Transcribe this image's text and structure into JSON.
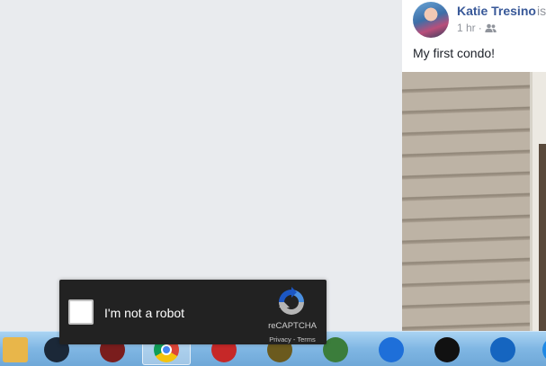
{
  "post": {
    "author": "Katie Tresino",
    "author_suffix": "is",
    "time": "1 hr",
    "separator": "·",
    "privacy_icon": "friends-icon",
    "text": "My first condo!"
  },
  "captcha": {
    "label": "I'm not a robot",
    "brand": "reCAPTCHA",
    "privacy_link": "Privacy",
    "link_separator": "-",
    "terms_link": "Terms",
    "logo_icon": "recaptcha-logo-icon"
  },
  "taskbar": {
    "apps": [
      {
        "icon": "file-explorer-icon",
        "color": "#e8b64a"
      },
      {
        "icon": "steam-icon",
        "color": "#1b2838"
      },
      {
        "icon": "gear-app-icon",
        "color": "#7a1d1d"
      },
      {
        "icon": "chrome-icon",
        "color": "#4285f4",
        "active": true
      },
      {
        "icon": "security-shield-icon",
        "color": "#c62828"
      },
      {
        "icon": "game-icon",
        "color": "#6b5a1e"
      },
      {
        "icon": "shield-app-icon",
        "color": "#3b7d3b"
      },
      {
        "icon": "g-app-icon",
        "color": "#1e6fd9"
      },
      {
        "icon": "gamepad-icon",
        "color": "#111111"
      },
      {
        "icon": "diamond-app-icon",
        "color": "#1565c0"
      },
      {
        "icon": "app-icon",
        "color": "#1e88e5"
      }
    ]
  },
  "colors": {
    "page_background": "#e9ebee",
    "author_link": "#385898",
    "captcha_background": "#222222"
  }
}
